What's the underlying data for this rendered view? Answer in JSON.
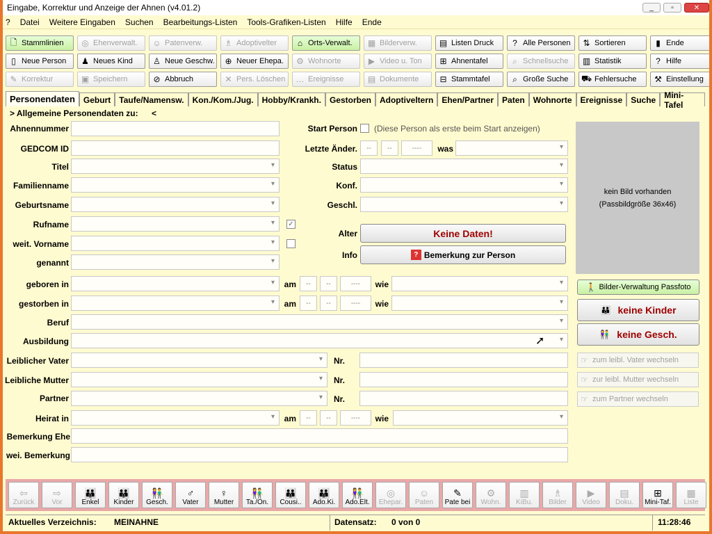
{
  "window": {
    "title": "Eingabe, Korrektur und Anzeige der Ahnen (v4.01.2)"
  },
  "menu": [
    "?",
    "Datei",
    "Weitere Eingaben",
    "Suchen",
    "Bearbeitungs-Listen",
    "Tools-Grafiken-Listen",
    "Hilfe",
    "Ende"
  ],
  "toolbar": {
    "row1": [
      {
        "label": "Stammlinien",
        "icon": "tree-icon",
        "g": "🗋",
        "enabled": true,
        "green": true
      },
      {
        "label": "Ehenverwalt.",
        "icon": "rings-icon",
        "g": "◎",
        "enabled": false
      },
      {
        "label": "Patenverw.",
        "icon": "godparent-icon",
        "g": "☺",
        "enabled": false
      },
      {
        "label": "Adoptivelter",
        "icon": "adoptive-icon",
        "g": "♗",
        "enabled": false
      },
      {
        "label": "Orts-Verwalt.",
        "icon": "location-icon",
        "g": "⌂",
        "enabled": true,
        "green": true
      },
      {
        "label": "Bilderverw.",
        "icon": "picture-icon",
        "g": "▦",
        "enabled": false
      },
      {
        "label": "Listen Druck",
        "icon": "print-list-icon",
        "g": "▤",
        "enabled": true
      },
      {
        "label": "Alle Personen",
        "icon": "all-persons-icon",
        "g": "?",
        "enabled": true
      },
      {
        "label": "Sortieren",
        "icon": "sort-icon",
        "g": "⇅",
        "enabled": true
      },
      {
        "label": "Ende",
        "icon": "exit-icon",
        "g": "▮",
        "enabled": true
      }
    ],
    "row2": [
      {
        "label": "Neue Person",
        "icon": "new-person-icon",
        "g": "▯",
        "enabled": true
      },
      {
        "label": "Neues Kind",
        "icon": "new-child-icon",
        "g": "♟",
        "enabled": true
      },
      {
        "label": "Neue Geschw.",
        "icon": "new-sibling-icon",
        "g": "♙",
        "enabled": true
      },
      {
        "label": "Neuer Ehepa.",
        "icon": "new-couple-icon",
        "g": "⊕",
        "enabled": true
      },
      {
        "label": "Wohnorte",
        "icon": "residence-icon",
        "g": "⚙",
        "enabled": false
      },
      {
        "label": "Video u. Ton",
        "icon": "video-icon",
        "g": "▶",
        "enabled": false
      },
      {
        "label": "Ahnentafel",
        "icon": "pedigree-icon",
        "g": "⊞",
        "enabled": true
      },
      {
        "label": "Schnellsuche",
        "icon": "quick-search-icon",
        "g": "⌕",
        "enabled": false
      },
      {
        "label": "Statistik",
        "icon": "statistics-icon",
        "g": "▥",
        "enabled": true
      },
      {
        "label": "Hilfe",
        "icon": "help-icon",
        "g": "?",
        "enabled": true
      }
    ],
    "row3": [
      {
        "label": "Korrektur",
        "icon": "edit-icon",
        "g": "✎",
        "enabled": false
      },
      {
        "label": "Speichern",
        "icon": "save-icon",
        "g": "▣",
        "enabled": false
      },
      {
        "label": "Abbruch",
        "icon": "cancel-icon",
        "g": "⊘",
        "enabled": true
      },
      {
        "label": "Pers. Löschen",
        "icon": "delete-icon",
        "g": "✕",
        "enabled": false
      },
      {
        "label": "Ereignisse",
        "icon": "events-icon",
        "g": "…",
        "enabled": false
      },
      {
        "label": "Dokumente",
        "icon": "documents-icon",
        "g": "▤",
        "enabled": false
      },
      {
        "label": "Stammtafel",
        "icon": "family-tree-icon",
        "g": "⊟",
        "enabled": true
      },
      {
        "label": "Große Suche",
        "icon": "search-icon",
        "g": "⌕",
        "enabled": true
      },
      {
        "label": "Fehlersuche",
        "icon": "error-search-icon",
        "g": "⛟",
        "enabled": true
      },
      {
        "label": "Einstellung",
        "icon": "settings-icon",
        "g": "⚒",
        "enabled": true
      }
    ]
  },
  "tabs": [
    "Personendaten",
    "Geburt",
    "Taufe/Namensw.",
    "Kon./Kom./Jug.",
    "Hobby/Krankh.",
    "Gestorben",
    "Adoptiveltern",
    "Ehen/Partner",
    "Paten",
    "Wohnorte",
    "Ereignisse",
    "Suche",
    "Mini-Tafel"
  ],
  "section": {
    "title": "> Allgemeine Personendaten zu:",
    "marker": "<"
  },
  "fields": {
    "ahnennummer": "Ahnennummer",
    "gedcom": "GEDCOM ID",
    "titel": "Titel",
    "familienname": "Familienname",
    "geburtsname": "Geburtsname",
    "rufname": "Rufname",
    "weit_vorname": "weit. Vorname",
    "genannt": "genannt",
    "geboren": "geboren in",
    "gestorben": "gestorben in",
    "beruf": "Beruf",
    "ausbildung": "Ausbildung",
    "vater": "Leiblicher Vater",
    "mutter": "Leibliche Mutter",
    "partner": "Partner",
    "heirat": "Heirat in",
    "bem_ehe": "Bemerkung Ehe",
    "wei_bem": "wei. Bemerkung",
    "start_person": "Start Person",
    "start_hint": "(Diese Person als erste beim Start anzeigen)",
    "letzte": "Letzte Änder.",
    "was": "was",
    "status": "Status",
    "konf": "Konf.",
    "geschl": "Geschl.",
    "alter": "Alter",
    "info": "Info",
    "am": "am",
    "wie": "wie",
    "nr": "Nr.",
    "date_dd": "--",
    "date_mm": "--",
    "date_yyyy": "----"
  },
  "buttons": {
    "keine_daten": "Keine Daten!",
    "bemerkung": "Bemerkung zur Person",
    "bilder_verw": "Bilder-Verwaltung Passfoto",
    "keine_kinder": "keine Kinder",
    "keine_gesch": "keine Gesch.",
    "zum_vater": "zum leibl. Vater wechseln",
    "zur_mutter": "zur leibl. Mutter wechseln",
    "zum_partner": "zum Partner wechseln"
  },
  "photo": {
    "line1": "kein Bild vorhanden",
    "line2": "(Passbildgröße 36x46)"
  },
  "bottom": [
    {
      "label": "Zurück",
      "icon": "back-arrow-icon",
      "g": "⇦",
      "enabled": false
    },
    {
      "label": "Vor",
      "icon": "forward-arrow-icon",
      "g": "⇨",
      "enabled": false
    },
    {
      "label": "Enkel",
      "icon": "grandchildren-icon",
      "g": "👪",
      "enabled": true
    },
    {
      "label": "Kinder",
      "icon": "children-icon",
      "g": "👪",
      "enabled": true
    },
    {
      "label": "Gesch.",
      "icon": "siblings-icon",
      "g": "👫",
      "enabled": true
    },
    {
      "label": "Vater",
      "icon": "father-icon",
      "g": "♂",
      "enabled": true
    },
    {
      "label": "Mutter",
      "icon": "mother-icon",
      "g": "♀",
      "enabled": true
    },
    {
      "label": "Ta./On.",
      "icon": "aunt-uncle-icon",
      "g": "👫",
      "enabled": true
    },
    {
      "label": "Cousi..",
      "icon": "cousins-icon",
      "g": "👪",
      "enabled": true
    },
    {
      "label": "Ado.Ki.",
      "icon": "adopted-child-icon",
      "g": "👪",
      "enabled": true
    },
    {
      "label": "Ado.Elt.",
      "icon": "adoptive-parents-icon",
      "g": "👫",
      "enabled": true
    },
    {
      "label": "Ehepar.",
      "icon": "spouse-icon",
      "g": "◎",
      "enabled": false
    },
    {
      "label": "Paten",
      "icon": "godparents-icon",
      "g": "☺",
      "enabled": false
    },
    {
      "label": "Pate bei",
      "icon": "godparent-of-icon",
      "g": "✎",
      "enabled": true
    },
    {
      "label": "Wohn.",
      "icon": "residences-icon",
      "g": "⚙",
      "enabled": false
    },
    {
      "label": "KiBu.",
      "icon": "church-book-icon",
      "g": "▥",
      "enabled": false
    },
    {
      "label": "Bilder",
      "icon": "pictures-icon",
      "g": "♗",
      "enabled": false
    },
    {
      "label": "Video",
      "icon": "video-icon",
      "g": "▶",
      "enabled": false
    },
    {
      "label": "Doku.",
      "icon": "document-icon",
      "g": "▤",
      "enabled": false
    },
    {
      "label": "Mini-Taf.",
      "icon": "mini-chart-icon",
      "g": "⊞",
      "enabled": true
    },
    {
      "label": "Liste",
      "icon": "list-icon",
      "g": "▦",
      "enabled": false
    }
  ],
  "status": {
    "verz_label": "Aktuelles Verzeichnis:",
    "verz": "MEINAHNE",
    "ds_label": "Datensatz:",
    "ds": "0 von 0",
    "time": "11:28:46"
  }
}
